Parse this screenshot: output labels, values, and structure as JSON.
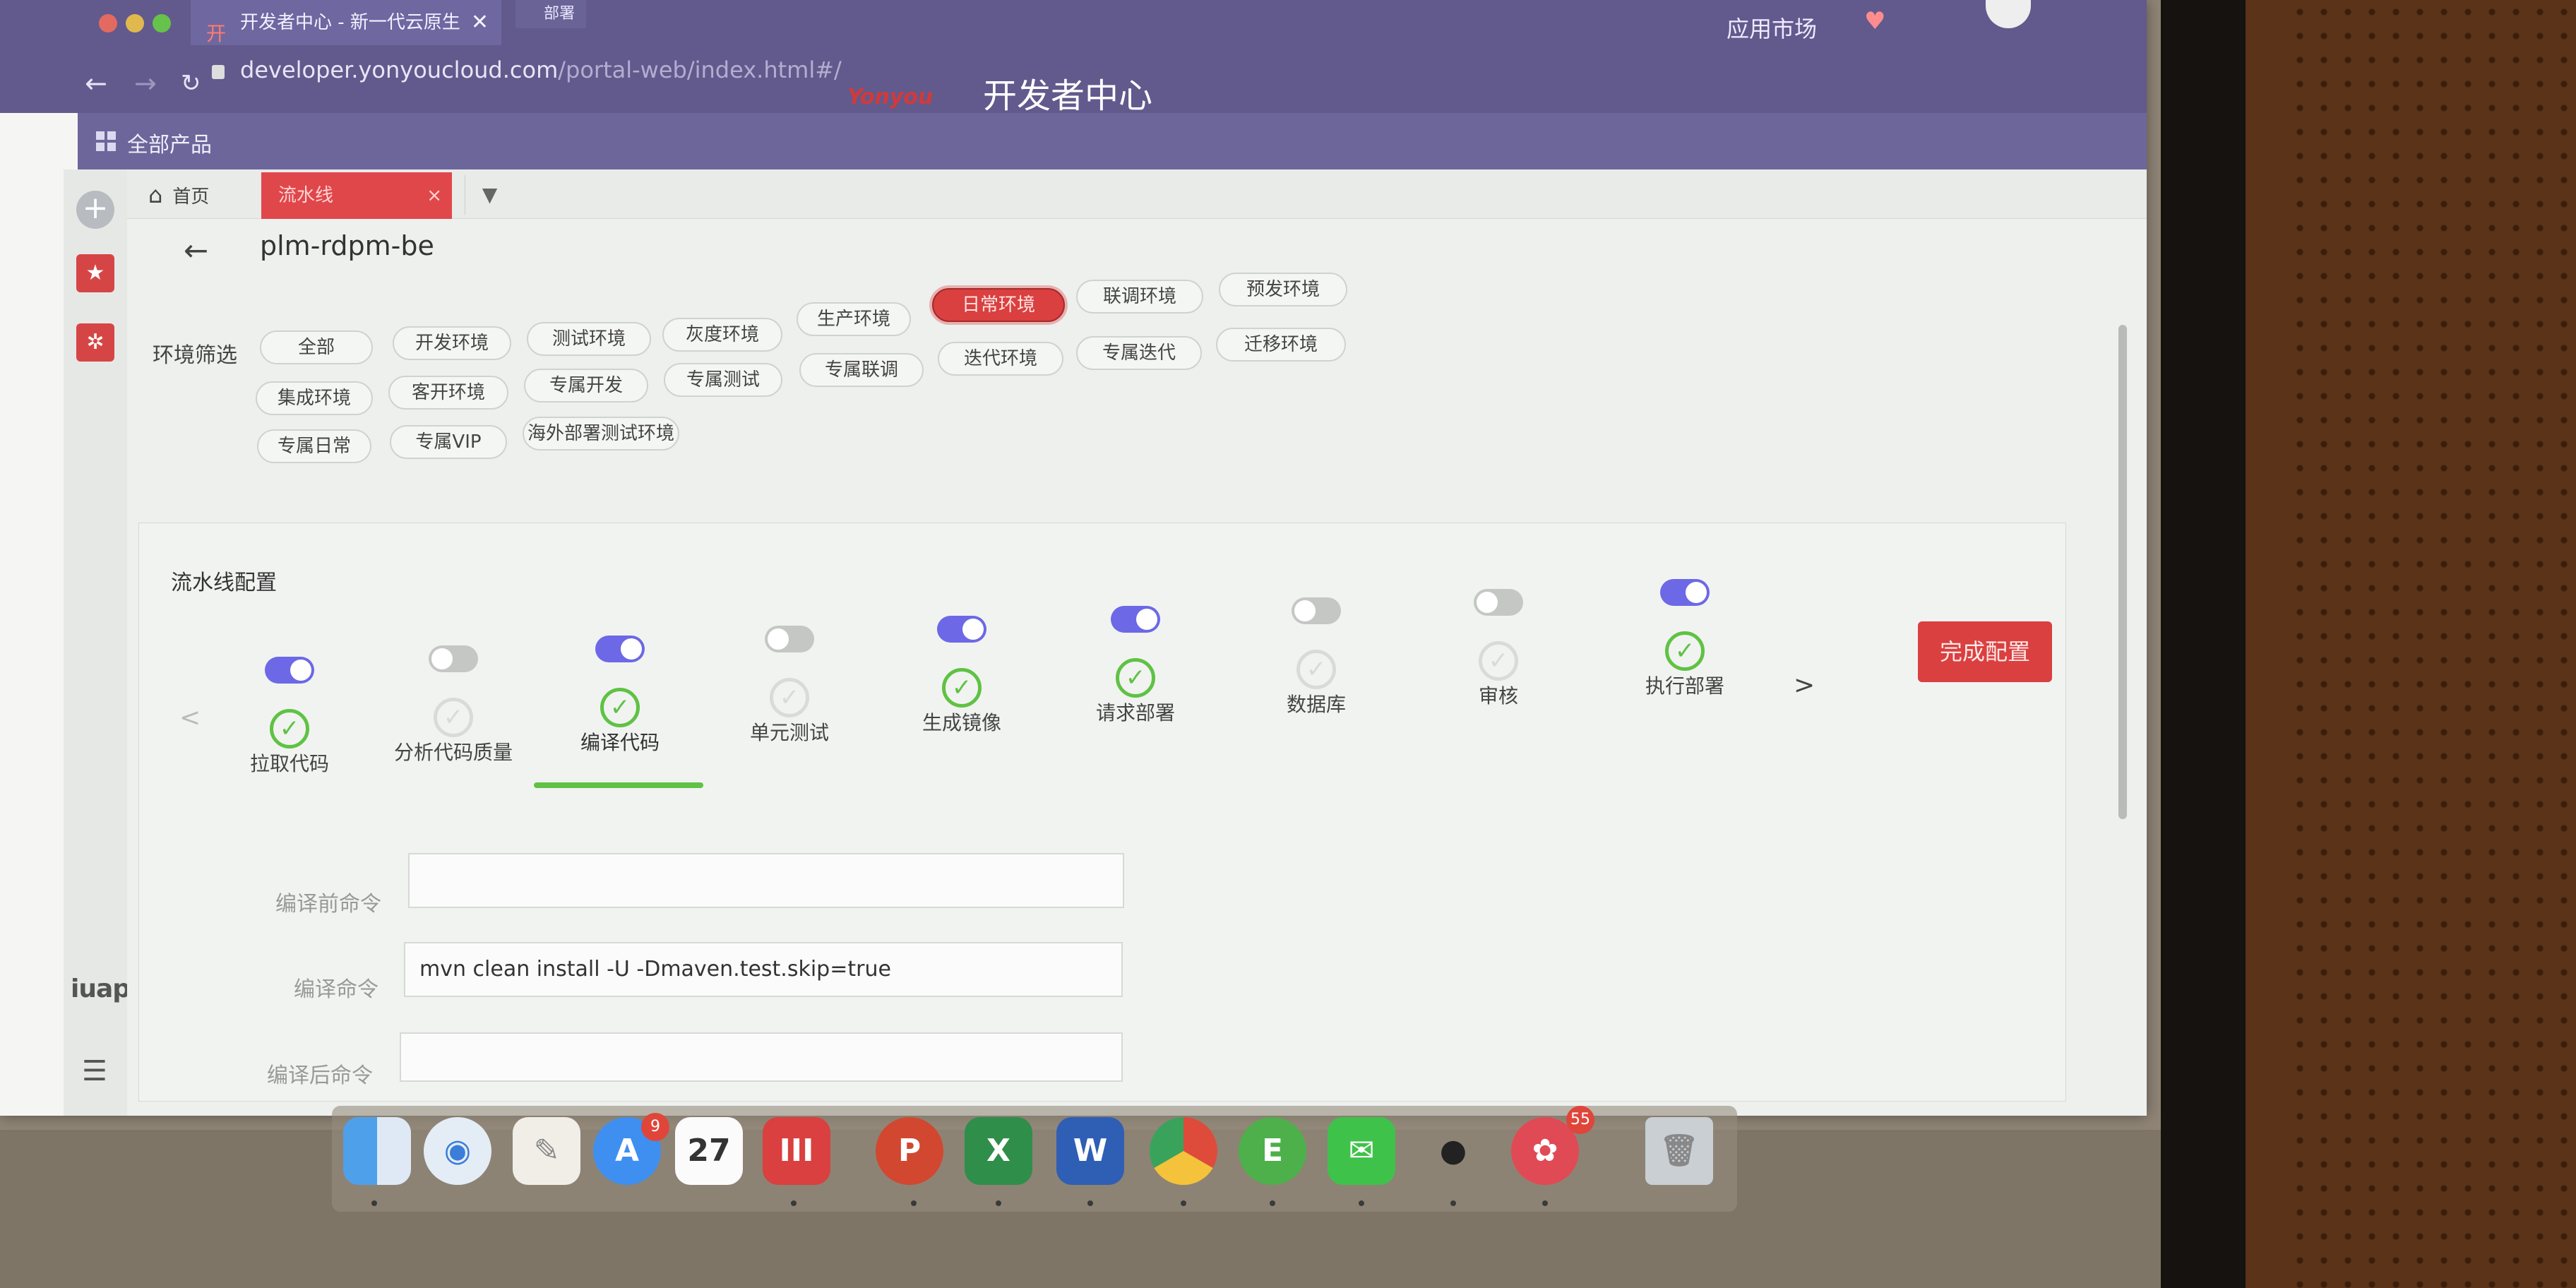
{
  "browser": {
    "tab_title": "开发者中心 - 新一代云原生",
    "tab_close": "✕",
    "tab2_title": "部署",
    "url_host": "developer.yonyoucloud.com",
    "url_path": "/portal-web/index.html#/",
    "app_market": "应用市场",
    "brand_logo": "Yonyou",
    "brand_title": "开发者中心"
  },
  "product_bar": {
    "label": "全部产品"
  },
  "sidebar": {
    "brand": "iuap",
    "menu_glyph": "☰"
  },
  "tabs": {
    "home_label": "首页",
    "active_label": "流水线",
    "close_glyph": "×",
    "dropdown_glyph": "▼"
  },
  "page": {
    "back_glyph": "←",
    "project_name": "plm-rdpm-be"
  },
  "env_filter": {
    "label": "环境筛选",
    "selected": "日常环境",
    "chips": [
      "全部",
      "开发环境",
      "测试环境",
      "灰度环境",
      "生产环境",
      "日常环境",
      "联调环境",
      "预发环境",
      "集成环境",
      "客开环境",
      "专属开发",
      "专属测试",
      "专属联调",
      "迭代环境",
      "专属迭代",
      "迁移环境",
      "专属日常",
      "专属VIP",
      "海外部署测试环境"
    ]
  },
  "pipeline": {
    "title": "流水线配置",
    "prev_glyph": "<",
    "next_glyph": ">",
    "finish_label": "完成配置",
    "active_step": "编译代码",
    "check_glyph": "✓",
    "steps": [
      {
        "name": "拉取代码",
        "enabled": true
      },
      {
        "name": "分析代码质量",
        "enabled": false
      },
      {
        "name": "编译代码",
        "enabled": true
      },
      {
        "name": "单元测试",
        "enabled": false
      },
      {
        "name": "生成镜像",
        "enabled": true
      },
      {
        "name": "请求部署",
        "enabled": true
      },
      {
        "name": "数据库",
        "enabled": false
      },
      {
        "name": "审核",
        "enabled": false
      },
      {
        "name": "执行部署",
        "enabled": true
      }
    ]
  },
  "compile_form": {
    "pre_label": "编译前命令",
    "pre_value": "",
    "cmd_label": "编译命令",
    "cmd_value": "mvn clean install -U -Dmaven.test.skip=true",
    "post_label": "编译后命令",
    "post_value": ""
  },
  "dock": {
    "calendar_day": "27",
    "appstore_badge": "9",
    "app_badge": "55",
    "items": [
      "finder-icon",
      "safari-icon",
      "notes-icon",
      "app-store-icon",
      "calendar-icon",
      "app-icon",
      "powerpoint-icon",
      "excel-icon",
      "word-icon",
      "chrome-icon",
      "evernote-icon",
      "wechat-icon",
      "qq-icon",
      "app-icon-2",
      "trash-icon"
    ]
  }
}
